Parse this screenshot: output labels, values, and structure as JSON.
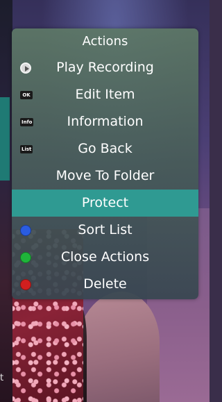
{
  "background": {
    "partial_text": "t"
  },
  "actions_menu": {
    "title": "Actions",
    "items": [
      {
        "label": "Play Recording",
        "icon": "play-icon",
        "selected": false
      },
      {
        "label": "Edit Item",
        "icon": "ok-key-icon",
        "key_text": "OK",
        "selected": false
      },
      {
        "label": "Information",
        "icon": "info-key-icon",
        "key_text": "Info",
        "selected": false
      },
      {
        "label": "Go Back",
        "icon": "list-key-icon",
        "key_text": "List",
        "selected": false
      },
      {
        "label": "Move To Folder",
        "icon": "",
        "selected": false
      },
      {
        "label": "Protect",
        "icon": "",
        "selected": true
      },
      {
        "label": "Sort List",
        "icon": "blue-button-icon",
        "selected": false
      },
      {
        "label": "Close Actions",
        "icon": "green-button-icon",
        "selected": false
      },
      {
        "label": "Delete",
        "icon": "red-button-icon",
        "selected": false
      }
    ]
  },
  "colors": {
    "selected_row": "#2f9a92",
    "blue_button": "#2a5ce0",
    "green_button": "#1fb53a",
    "red_button": "#d11f1f"
  }
}
